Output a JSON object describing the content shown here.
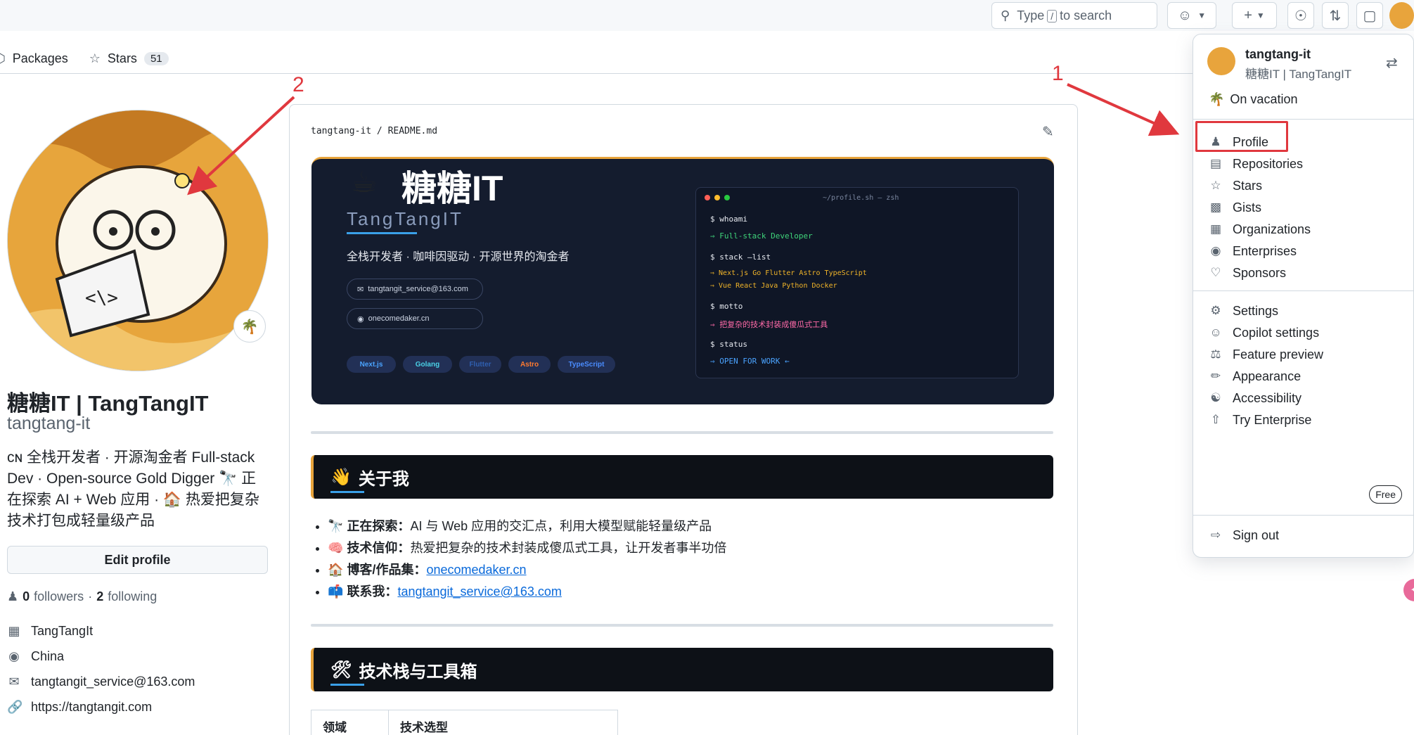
{
  "header": {
    "search_text_before": "Type",
    "search_key": "/",
    "search_text_after": "to search",
    "plus_label": "+"
  },
  "tabs": [
    {
      "label": "Packages",
      "icon": "package-icon"
    },
    {
      "label": "Stars",
      "icon": "star-icon",
      "count": "51"
    }
  ],
  "profile": {
    "name": "糖糖IT | TangTangIT",
    "login": "tangtang-it",
    "bio": "ᴄɴ 全栈开发者 · 开源淘金者 Full-stack Dev · Open-source Gold Digger 🔭 正在探索 AI + Web 应用 · 🏠 热爱把复杂技术打包成轻量级产品",
    "edit_label": "Edit profile",
    "followers": "0",
    "followers_label": "followers",
    "following": "2",
    "following_label": "following",
    "company": "TangTangIt",
    "location": "China",
    "email": "tangtangit_service@163.com",
    "website": "https://tangtangit.com",
    "status_emoji": "🌴"
  },
  "readme": {
    "owner": "tangtang-it",
    "sep": "/",
    "file": "README.md",
    "banner": {
      "cup": "☕",
      "title": "糖糖IT",
      "subtitle": "TangTangIT",
      "desc": "全栈开发者 · 咖啡因驱动 · 开源世界的淘金者",
      "email": "tangtangit_service@163.com",
      "site": "onecomedaker.cn",
      "tags": [
        "Next.js",
        "Golang",
        "Flutter",
        "Astro",
        "TypeScript"
      ],
      "term_title": "~/profile.sh — zsh",
      "term": {
        "c1": "$ whoami",
        "o1": "⇒ Full-stack Developer",
        "c2": "$ stack —list",
        "o2": "⇒ Next.js Go Flutter Astro TypeScript",
        "o3": "⇒ Vue React Java Python Docker",
        "c3": "$ motto",
        "o4": "⇒ 把复杂的技术封装成傻瓜式工具",
        "c4": "$ status",
        "o5": "⇒ OPEN FOR WORK ←"
      }
    },
    "about_icon": "👋",
    "about_title": "关于我",
    "about_items": [
      {
        "icon": "🔭",
        "label": "正在探索：",
        "text": "AI 与 Web 应用的交汇点，利用大模型赋能轻量级产品"
      },
      {
        "icon": "🧠",
        "label": "技术信仰：",
        "text": "热爱把复杂的技术封装成傻瓜式工具，让开发者事半功倍"
      },
      {
        "icon": "🏠",
        "label": "博客/作品集：",
        "link": "onecomedaker.cn"
      },
      {
        "icon": "📫",
        "label": "联系我：",
        "link": "tangtangit_service@163.com"
      }
    ],
    "stack_icon": "🛠",
    "stack_title": "技术栈与工具箱",
    "table_headers": [
      "领域",
      "技术选型"
    ]
  },
  "menu": {
    "username": "tangtang-it",
    "displayname": "糖糖IT | TangTangIT",
    "status": "On vacation",
    "status_emoji": "🌴",
    "items": [
      {
        "label": "Profile",
        "icon": "person-icon"
      },
      {
        "label": "Repositories",
        "icon": "repo-icon"
      },
      {
        "label": "Stars",
        "icon": "star-icon"
      },
      {
        "label": "Gists",
        "icon": "code-square-icon"
      },
      {
        "label": "Organizations",
        "icon": "organization-icon"
      },
      {
        "label": "Enterprises",
        "icon": "globe-icon"
      },
      {
        "label": "Sponsors",
        "icon": "heart-icon"
      },
      {
        "label": "Settings",
        "icon": "gear-icon"
      },
      {
        "label": "Copilot settings",
        "icon": "copilot-icon"
      },
      {
        "label": "Feature preview",
        "icon": "beaker-icon"
      },
      {
        "label": "Appearance",
        "icon": "paintbrush-icon"
      },
      {
        "label": "Accessibility",
        "icon": "accessibility-icon"
      },
      {
        "label": "Try Enterprise",
        "icon": "upload-icon",
        "badge": "Free"
      },
      {
        "label": "Sign out",
        "icon": "sign-out-icon"
      }
    ]
  },
  "annotations": {
    "one": "1",
    "two": "2"
  },
  "colors": {
    "accent": "#0969da",
    "annotation": "#e0383e",
    "banner_bg": "#141c2e"
  }
}
